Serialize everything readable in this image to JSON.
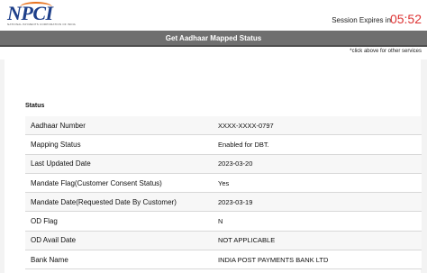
{
  "header": {
    "logo_text": "NPCI",
    "logo_subtext": "NATIONAL PAYMENTS CORPORATION OF INDIA",
    "session_label": "Session Expires in",
    "session_time": "05:52"
  },
  "titlebar": {
    "title": "Get Aadhaar Mapped Status"
  },
  "note": "*click above for other services",
  "status": {
    "heading": "Status",
    "rows": [
      {
        "label": "Aadhaar Number",
        "value": "XXXX-XXXX-0797"
      },
      {
        "label": "Mapping Status",
        "value": "Enabled for DBT."
      },
      {
        "label": "Last Updated Date",
        "value": "2023-03-20"
      },
      {
        "label": "Mandate Flag(Customer Consent Status)",
        "value": "Yes"
      },
      {
        "label": "Mandate Date(Requested Date By Customer)",
        "value": "2023-03-19"
      },
      {
        "label": "OD Flag",
        "value": "N"
      },
      {
        "label": "OD Avail Date",
        "value": "NOT APPLICABLE"
      },
      {
        "label": "Bank Name",
        "value": "INDIA POST PAYMENTS BANK LTD"
      }
    ]
  },
  "colors": {
    "titlebar": "#6f6f6f",
    "logo_blue": "#1d3f8a",
    "logo_orange": "#e8731f",
    "session_time": "#dd3333"
  }
}
